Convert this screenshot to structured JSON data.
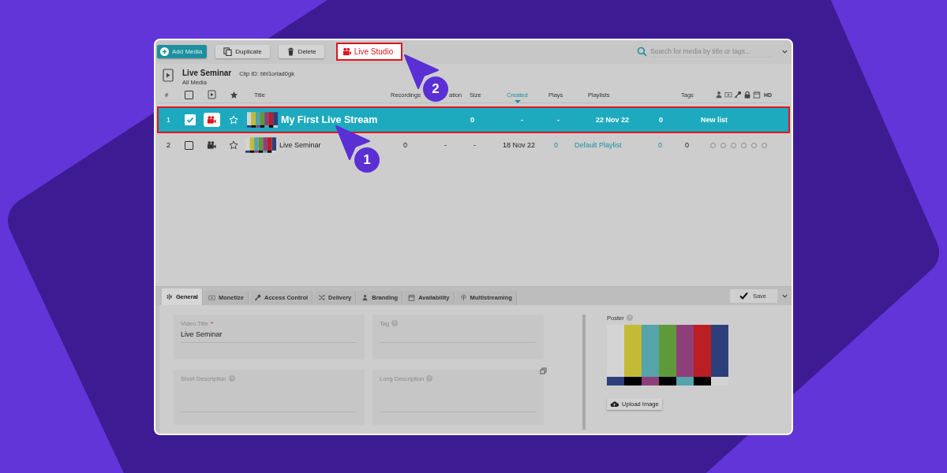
{
  "toolbar": {
    "buttons": [
      {
        "kind": "add",
        "label": "Add Media",
        "highlighted": false
      },
      {
        "kind": "duplicate",
        "label": "Duplicate",
        "highlighted": false
      },
      {
        "kind": "delete",
        "label": "Delete",
        "highlighted": false
      },
      {
        "kind": "live",
        "label": "Live Studio",
        "highlighted": true
      }
    ],
    "search": {
      "placeholder": "Search for media by title or tags..."
    }
  },
  "header": {
    "title": "Live Seminar",
    "clip_id": "Clip ID: bbl1orlad0gk",
    "breadcrumb": "All Media"
  },
  "columns": {
    "number": "#",
    "select_all": {
      "checked": false
    },
    "labels": [
      {
        "label": "Title",
        "sorted": false
      },
      {
        "label": "Recordings",
        "sorted": false
      },
      {
        "label": "ation",
        "sorted": false
      },
      {
        "label": "Size",
        "sorted": false
      },
      {
        "label": "Created",
        "sorted": true
      },
      {
        "label": "Plays",
        "sorted": false
      },
      {
        "label": "Playlists",
        "sorted": false
      },
      {
        "label": "Tags",
        "sorted": false
      }
    ],
    "flags_label": "HD"
  },
  "rows": [
    {
      "number": "1",
      "selected": true,
      "checked": true,
      "title": "My First Live Stream",
      "cells": [
        {
          "text": "0",
          "link": false
        },
        {
          "text": "-",
          "link": false
        },
        {
          "text": "-",
          "link": false
        },
        {
          "text": "22 Nov 22",
          "link": false
        },
        {
          "text": "0",
          "link": false
        },
        {
          "text": "New list",
          "link": false
        }
      ]
    },
    {
      "number": "2",
      "selected": false,
      "checked": false,
      "title": "Live Seminar",
      "cells": [
        {
          "text": "0",
          "link": false
        },
        {
          "text": "-",
          "link": false
        },
        {
          "text": "-",
          "link": false
        },
        {
          "text": "18 Nov 22",
          "link": false
        },
        {
          "text": "0",
          "link": true
        },
        {
          "text": "Default Playlist",
          "link": true
        },
        {
          "text": "0",
          "link": true
        },
        {
          "text": "0",
          "link": false
        }
      ],
      "flags": [
        {
          "on": false
        },
        {
          "on": false
        },
        {
          "on": false
        },
        {
          "on": false
        },
        {
          "on": false
        },
        {
          "on": false
        }
      ]
    }
  ],
  "callouts": [
    {
      "number": "1"
    },
    {
      "number": "2"
    }
  ],
  "tabs": [
    {
      "kind": "gear",
      "label": "General",
      "selected": true
    },
    {
      "kind": "money",
      "label": "Monetize",
      "selected": false
    },
    {
      "kind": "key",
      "label": "Access Control",
      "selected": false
    },
    {
      "kind": "shuffle",
      "label": "Delivery",
      "selected": false
    },
    {
      "kind": "person",
      "label": "Branding",
      "selected": false
    },
    {
      "kind": "calendar",
      "label": "Availability",
      "selected": false
    },
    {
      "kind": "signal",
      "label": "Multistreaming",
      "selected": false
    }
  ],
  "save_button": "Save",
  "fields": [
    {
      "label": "Video Title",
      "required_mark": "*",
      "help": false,
      "value": "Live Seminar"
    },
    {
      "label": "Tag",
      "help": true
    },
    {
      "label": "Short Description",
      "help": true
    },
    {
      "label": "Long Description",
      "help": true,
      "expandable": true
    }
  ],
  "poster": {
    "label": "Poster",
    "help": true,
    "upload_button": "Upload Image"
  }
}
